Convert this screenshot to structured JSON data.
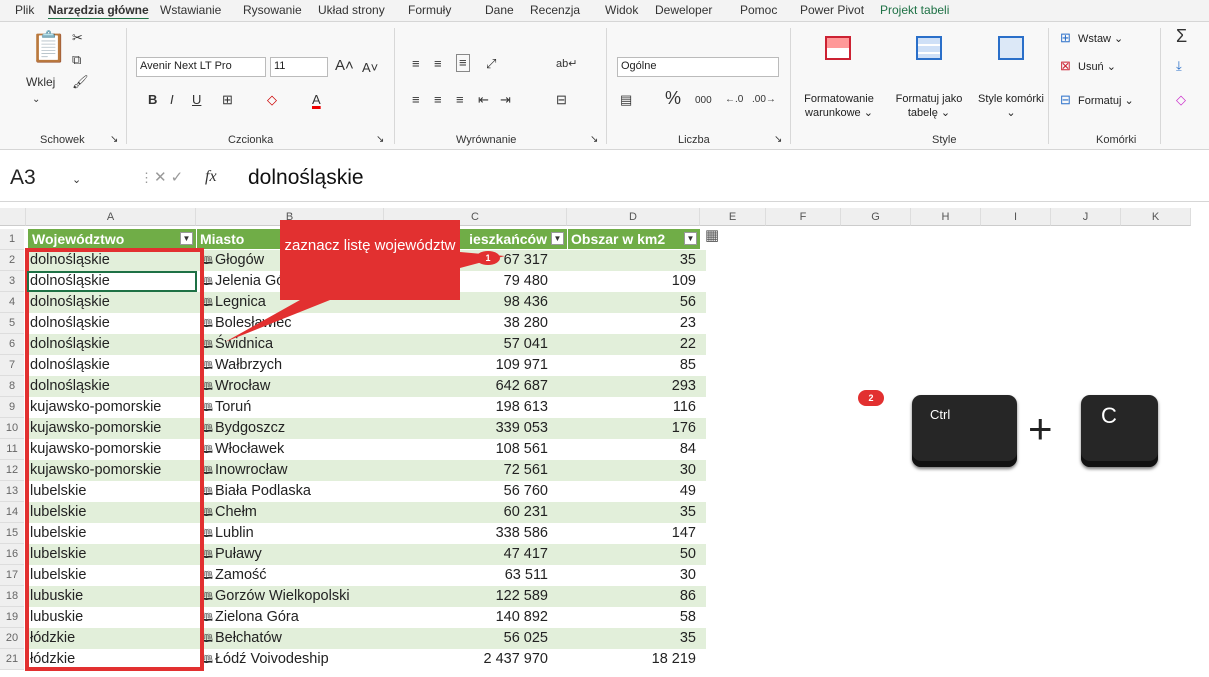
{
  "tabs": [
    "Plik",
    "Narzędzia główne",
    "Wstawianie",
    "Rysowanie",
    "Układ strony",
    "Formuły",
    "Dane",
    "Recenzja",
    "Widok",
    "Deweloper",
    "Pomoc",
    "Power Pivot",
    "Projekt tabeli"
  ],
  "ribbon": {
    "paste_label": "Wklej",
    "font_name": "Avenir Next LT Pro",
    "font_size": "11",
    "number_format": "Ogólne",
    "cond_format": "Formatowanie warunkowe ⌄",
    "format_table": "Formatuj jako tabelę ⌄",
    "cell_styles": "Style komórki ⌄",
    "insert": "Wstaw ⌄",
    "delete": "Usuń ⌄",
    "format": "Formatuj ⌄",
    "groups": {
      "clipboard": "Schowek",
      "font": "Czcionka",
      "alignment": "Wyrównanie",
      "number": "Liczba",
      "styles": "Style",
      "cells": "Komórki"
    }
  },
  "formula_bar": {
    "name_box": "A3",
    "value": "dolnośląskie"
  },
  "columns": [
    "A",
    "B",
    "C",
    "D",
    "E",
    "F",
    "G",
    "H",
    "I",
    "J",
    "K"
  ],
  "table": {
    "headers": [
      "Województwo",
      "Miasto",
      "ieszkańców",
      "Obszar w km2"
    ],
    "rows": [
      [
        "dolnośląskie",
        "Głogów",
        "67 317",
        "35"
      ],
      [
        "dolnośląskie",
        "Jelenia Góra",
        "79 480",
        "109"
      ],
      [
        "dolnośląskie",
        "Legnica",
        "98 436",
        "56"
      ],
      [
        "dolnośląskie",
        "Bolesławiec",
        "38 280",
        "23"
      ],
      [
        "dolnośląskie",
        "Świdnica",
        "57 041",
        "22"
      ],
      [
        "dolnośląskie",
        "Wałbrzych",
        "109 971",
        "85"
      ],
      [
        "dolnośląskie",
        "Wrocław",
        "642 687",
        "293"
      ],
      [
        "kujawsko-pomorskie",
        "Toruń",
        "198 613",
        "116"
      ],
      [
        "kujawsko-pomorskie",
        "Bydgoszcz",
        "339 053",
        "176"
      ],
      [
        "kujawsko-pomorskie",
        "Włocławek",
        "108 561",
        "84"
      ],
      [
        "kujawsko-pomorskie",
        "Inowrocław",
        "72 561",
        "30"
      ],
      [
        "lubelskie",
        "Biała Podlaska",
        "56 760",
        "49"
      ],
      [
        "lubelskie",
        "Chełm",
        "60 231",
        "35"
      ],
      [
        "lubelskie",
        "Lublin",
        "338 586",
        "147"
      ],
      [
        "lubelskie",
        "Puławy",
        "47 417",
        "50"
      ],
      [
        "lubelskie",
        "Zamość",
        "63 511",
        "30"
      ],
      [
        "lubuskie",
        "Gorzów Wielkopolski",
        "122 589",
        "86"
      ],
      [
        "lubuskie",
        "Zielona Góra",
        "140 892",
        "58"
      ],
      [
        "łódzkie",
        "Bełchatów",
        "56 025",
        "35"
      ],
      [
        "łódzkie",
        "Łódź Voivodeship",
        "2 437 970",
        "18 219"
      ]
    ]
  },
  "callout": {
    "text": "zaznacz listę województw",
    "step1": "1",
    "step2": "2"
  },
  "keys": {
    "ctrl": "Ctrl",
    "c": "C",
    "plus": "+"
  },
  "colors": {
    "header_green": "#70ad47",
    "band": "#e2efda",
    "annotation_red": "#e23030"
  }
}
